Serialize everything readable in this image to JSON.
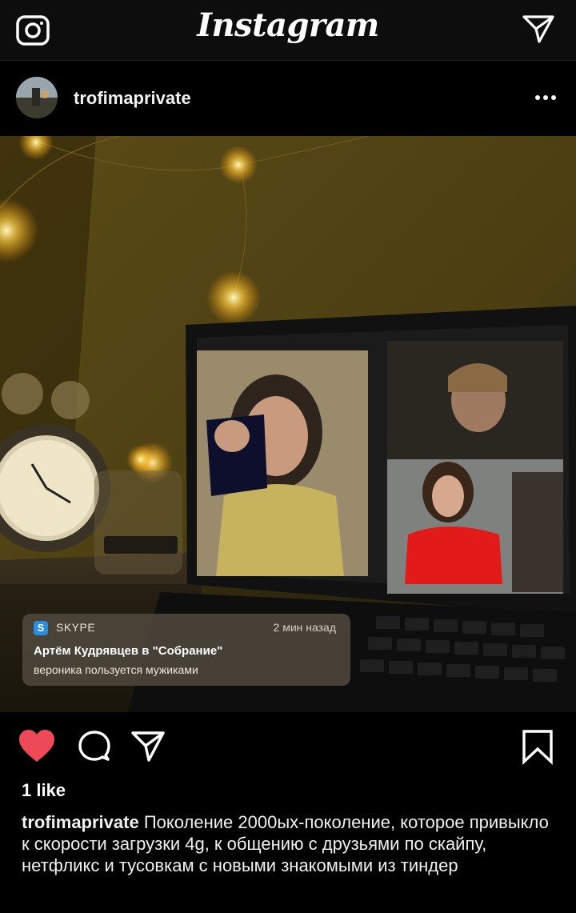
{
  "app": {
    "logo_text": "Instagram"
  },
  "post": {
    "username": "trofimaprivate",
    "likes_text": "1 like",
    "liked": true,
    "caption": "Поколение 2000ых-поколение, которое привыкло к скорости загрузки 4g, к общению с друзьями по скайпу, нетфликс и тусовкам с новыми знакомыми из тиндер"
  },
  "notification": {
    "app": "SKYPE",
    "time": "2 мин назад",
    "title": "Артём Кудрявцев в \"Собрание\"",
    "body": "вероника пользуется мужиками"
  },
  "icons": {
    "camera": "camera-icon",
    "direct": "direct-message-icon",
    "more": "more-options-icon",
    "like": "heart-icon",
    "comment": "comment-icon",
    "share": "share-icon",
    "save": "bookmark-icon"
  },
  "colors": {
    "heart": "#ed4956",
    "background": "#000000"
  }
}
